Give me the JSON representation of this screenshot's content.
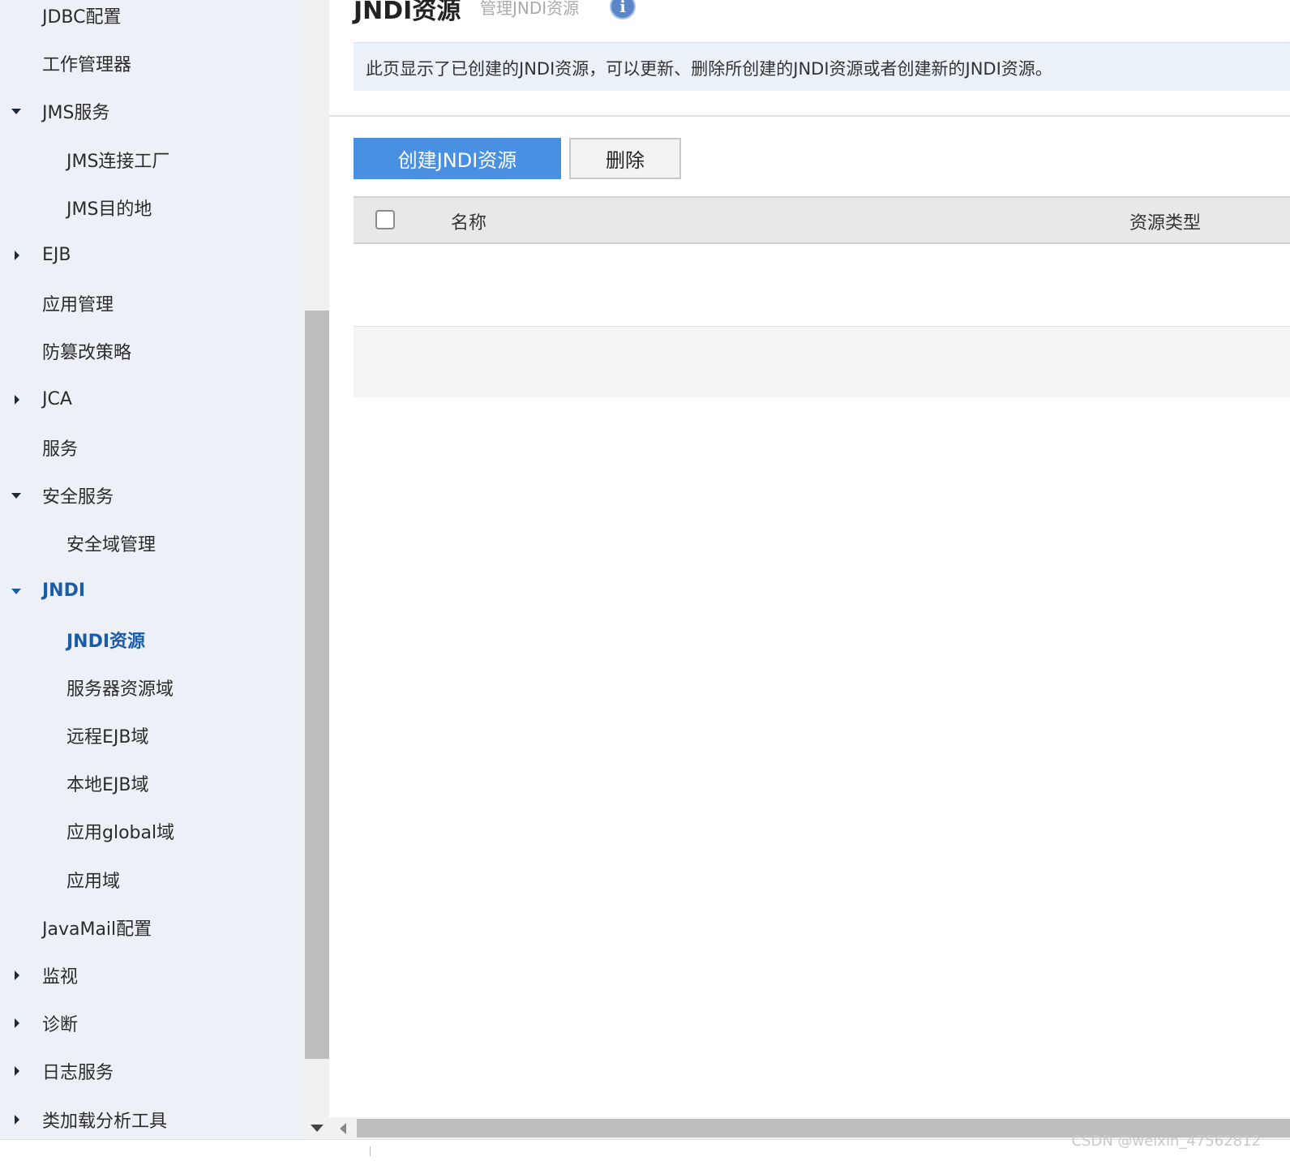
{
  "sidebar": {
    "items": [
      {
        "label": "JDBC配置",
        "level": 1,
        "caret": "none"
      },
      {
        "label": "工作管理器",
        "level": 1,
        "caret": "none"
      },
      {
        "label": "JMS服务",
        "level": 1,
        "caret": "down"
      },
      {
        "label": "JMS连接工厂",
        "level": 2,
        "caret": "none"
      },
      {
        "label": "JMS目的地",
        "level": 2,
        "caret": "none"
      },
      {
        "label": "EJB",
        "level": 1,
        "caret": "right"
      },
      {
        "label": "应用管理",
        "level": 1,
        "caret": "none"
      },
      {
        "label": "防篡改策略",
        "level": 1,
        "caret": "none"
      },
      {
        "label": "JCA",
        "level": 1,
        "caret": "right"
      },
      {
        "label": "服务",
        "level": 1,
        "caret": "none"
      },
      {
        "label": "安全服务",
        "level": 1,
        "caret": "down"
      },
      {
        "label": "安全域管理",
        "level": 2,
        "caret": "none"
      },
      {
        "label": "JNDI",
        "level": 1,
        "caret": "down",
        "active": true
      },
      {
        "label": "JNDI资源",
        "level": 2,
        "caret": "none",
        "active": true
      },
      {
        "label": "服务器资源域",
        "level": 2,
        "caret": "none"
      },
      {
        "label": "远程EJB域",
        "level": 2,
        "caret": "none"
      },
      {
        "label": "本地EJB域",
        "level": 2,
        "caret": "none"
      },
      {
        "label": "应用global域",
        "level": 2,
        "caret": "none"
      },
      {
        "label": "应用域",
        "level": 2,
        "caret": "none"
      },
      {
        "label": "JavaMail配置",
        "level": 1,
        "caret": "none"
      },
      {
        "label": "监视",
        "level": 1,
        "caret": "right"
      },
      {
        "label": "诊断",
        "level": 1,
        "caret": "right"
      },
      {
        "label": "日志服务",
        "level": 1,
        "caret": "right"
      },
      {
        "label": "类加载分析工具",
        "level": 1,
        "caret": "right"
      }
    ]
  },
  "header": {
    "title": "JNDI资源",
    "subtitle": "管理JNDI资源",
    "info_icon": "info-icon"
  },
  "description": "此页显示了已创建的JNDI资源，可以更新、删除所创建的JNDI资源或者创建新的JNDI资源。",
  "toolbar": {
    "create_label": "创建JNDI资源",
    "delete_label": "删除"
  },
  "table": {
    "columns": [
      "名称",
      "资源类型"
    ],
    "rows": []
  },
  "watermark": "CSDN @weixin_47562812",
  "colors": {
    "accent": "#4a90e2",
    "active_nav": "#1a5ca8",
    "sidebar_bg": "#edf1f7"
  }
}
